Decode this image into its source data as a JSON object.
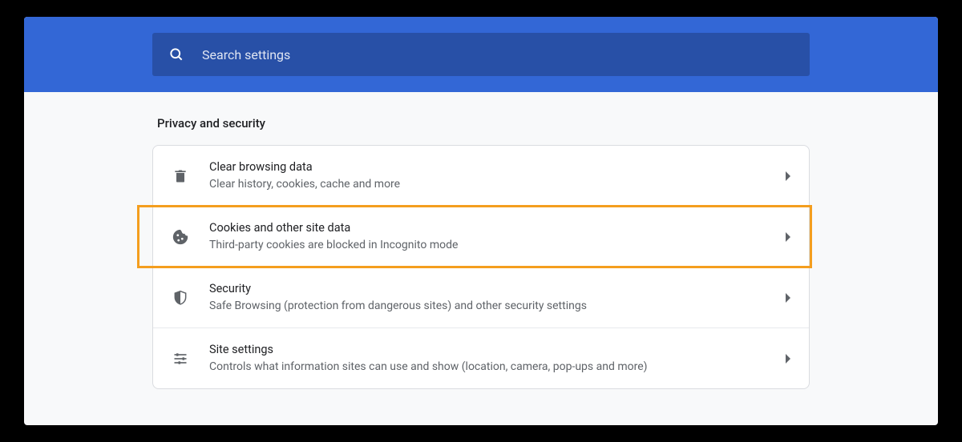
{
  "search": {
    "placeholder": "Search settings"
  },
  "section": {
    "title": "Privacy and security"
  },
  "items": [
    {
      "icon": "trash",
      "title": "Clear browsing data",
      "subtitle": "Clear history, cookies, cache and more",
      "highlighted": false
    },
    {
      "icon": "cookie",
      "title": "Cookies and other site data",
      "subtitle": "Third-party cookies are blocked in Incognito mode",
      "highlighted": true
    },
    {
      "icon": "shield",
      "title": "Security",
      "subtitle": "Safe Browsing (protection from dangerous sites) and other security settings",
      "highlighted": false
    },
    {
      "icon": "sliders",
      "title": "Site settings",
      "subtitle": "Controls what information sites can use and show (location, camera, pop-ups and more)",
      "highlighted": false
    }
  ]
}
